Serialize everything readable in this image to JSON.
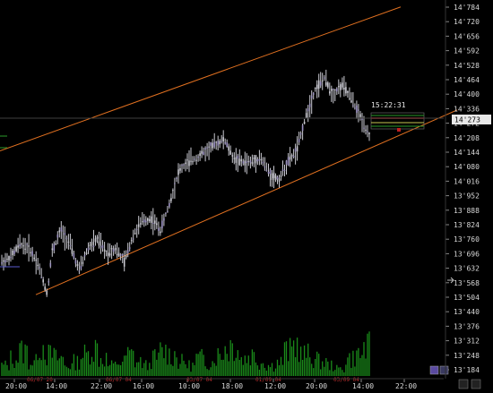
{
  "chart_data": {
    "type": "candlestick",
    "instrument_price_scale": "xx'yyy (1/32 style)",
    "y_ticks": [
      "14'784",
      "14'720",
      "14'656",
      "14'592",
      "14'528",
      "14'464",
      "14'400",
      "14'336",
      "14'272",
      "14'208",
      "14'144",
      "14'080",
      "14'016",
      "13'952",
      "13'888",
      "13'824",
      "13'760",
      "13'696",
      "13'632",
      "13'568",
      "13'504",
      "13'440",
      "13'376",
      "13'312",
      "13'248",
      "13'184"
    ],
    "ylim": [
      13.18,
      14.8
    ],
    "current_price_label": "14'273",
    "current_price": 14.273,
    "x_ticks": [
      "20:00",
      "14:00",
      "22:00",
      "16:00",
      "10:00",
      "18:00",
      "12:00",
      "20:00",
      "14:00",
      "22:00"
    ],
    "date_labels": [
      "06/07 20",
      "06/07 04",
      "03/07 04",
      "01/09 04",
      "03/09 04"
    ],
    "clock": "15:22:31",
    "channel": {
      "upper": [
        [
          0,
          14.15
        ],
        [
          1,
          14.785
        ]
      ],
      "lower": [
        [
          0,
          13.515
        ],
        [
          1,
          14.18
        ]
      ]
    },
    "price_path": [
      [
        0.0,
        13.66
      ],
      [
        0.02,
        13.68
      ],
      [
        0.04,
        13.74
      ],
      [
        0.06,
        13.72
      ],
      [
        0.08,
        13.65
      ],
      [
        0.1,
        13.52
      ],
      [
        0.11,
        13.7
      ],
      [
        0.13,
        13.8
      ],
      [
        0.15,
        13.74
      ],
      [
        0.17,
        13.62
      ],
      [
        0.19,
        13.72
      ],
      [
        0.21,
        13.76
      ],
      [
        0.23,
        13.7
      ],
      [
        0.25,
        13.72
      ],
      [
        0.27,
        13.66
      ],
      [
        0.29,
        13.78
      ],
      [
        0.31,
        13.84
      ],
      [
        0.33,
        13.85
      ],
      [
        0.35,
        13.8
      ],
      [
        0.37,
        13.92
      ],
      [
        0.39,
        14.06
      ],
      [
        0.41,
        14.1
      ],
      [
        0.43,
        14.12
      ],
      [
        0.45,
        14.15
      ],
      [
        0.47,
        14.18
      ],
      [
        0.49,
        14.2
      ],
      [
        0.51,
        14.12
      ],
      [
        0.53,
        14.1
      ],
      [
        0.55,
        14.1
      ],
      [
        0.57,
        14.12
      ],
      [
        0.59,
        14.05
      ],
      [
        0.61,
        14.02
      ],
      [
        0.63,
        14.1
      ],
      [
        0.65,
        14.15
      ],
      [
        0.67,
        14.3
      ],
      [
        0.69,
        14.42
      ],
      [
        0.71,
        14.47
      ],
      [
        0.73,
        14.4
      ],
      [
        0.75,
        14.44
      ],
      [
        0.77,
        14.38
      ],
      [
        0.79,
        14.3
      ],
      [
        0.81,
        14.22
      ]
    ],
    "volume_profile": [
      0.3,
      0.5,
      0.7,
      0.4,
      0.9,
      0.6,
      0.5,
      0.3,
      0.4,
      0.6,
      0.8,
      0.5,
      0.3,
      0.4,
      0.6,
      0.4,
      0.3,
      0.5,
      0.7,
      0.6,
      0.4,
      0.3,
      0.5,
      0.4,
      0.6,
      0.8,
      0.9,
      0.5,
      0.6,
      0.4,
      0.3,
      0.4,
      0.7,
      0.9,
      0.6,
      0.5,
      0.4,
      0.3,
      0.2,
      0.5,
      0.6,
      0.8
    ],
    "colors": {
      "background": "#000000",
      "candle": "#c8c8d0",
      "channel": "#e07020",
      "volume": "#1a8a1a",
      "price_line": "#505050",
      "axis_text": "#d8d8d8",
      "date_text": "#c03030",
      "badge_bg": "#e8e8e8",
      "tp": "#2a9a2a",
      "sl": "#c02020",
      "entry": "#c8c850"
    },
    "grid": false
  },
  "ui": {
    "cursor_arrow": "arrow-right-icon",
    "scroll_buttons": [
      "scroll-left-icon",
      "scroll-right-icon"
    ],
    "zoom_buttons": [
      "zoom-in-icon",
      "zoom-out-icon"
    ]
  }
}
